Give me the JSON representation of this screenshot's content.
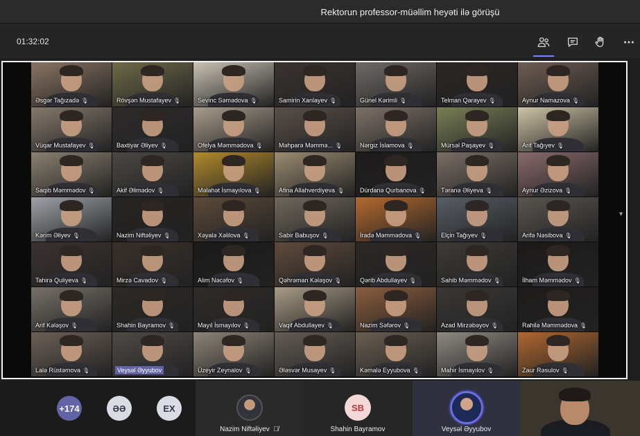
{
  "meeting": {
    "title": "Rektorun professor-müəllim heyəti ilə görüşü",
    "timer": "01:32:02"
  },
  "toolbar": {
    "icons": [
      "people-icon",
      "chat-icon",
      "raise-hand-icon",
      "more-options-icon"
    ]
  },
  "gallery": {
    "participants": [
      "Əsgər Tağızadə",
      "Rövşən Mustafayev",
      "Sevinc Səmədova",
      "Samirin Xanlayev",
      "Günel Kərimli",
      "Telman Qarayev",
      "Aynur Namazova",
      "Vüqar Mustafayev",
      "Baxtiyar Əliyev",
      "Ofelya Məmmədova",
      "Məhparə Məmmə...",
      "Nərgiz İslamova",
      "Mürsəl Paşayev",
      "Arif Tağıyev",
      "Saqib Məmmədov",
      "Akif Əlimədov",
      "Məlahət İsmayılova",
      "Afina Allahverdiyeva",
      "Dürdanə Qurbanova",
      "Təranə Əliyeva",
      "Aynur Əzizova",
      "Kərim Əliyev",
      "Nazim Niftəliyev",
      "Xəyalə Xəlilova",
      "Sabir Babuşov",
      "İradə Məmmədova",
      "Elçin Tağıyev",
      "Arifə Nəsibova",
      "Tahirə Quliyeva",
      "Mirzə Cavadov",
      "Alim Nəcəfov",
      "Qəhrəman Kələşov",
      "Qərib Abdullayev",
      "Sahib Məmmədov",
      "İlham Məmmədov",
      "Arif Kələşov",
      "Shahin Bayramov",
      "Mayıl İsmayılov",
      "Vaqif Abdullayev",
      "Nazim Səfərov",
      "Azad Mirzəbəyov",
      "Rahilə Məmmədova",
      "Lalə Rüstəmova",
      "Veysəl Əyyubov",
      "Üzeyir Zeynalov",
      "Ələsvər Musayev",
      "Kəmalə Eyyubova",
      "Mahir İsmayılov",
      "Zaur Rəsulov"
    ],
    "highlighted": "Veysəl Əyyubov"
  },
  "bottom": {
    "overflow_count": "+174",
    "bubble_1": "ƏƏ",
    "bubble_2": "EX",
    "stage": [
      {
        "name": "Nazim Niftəliyev",
        "muted": true
      },
      {
        "name": "Shahin Bayramov",
        "initials": "SB"
      },
      {
        "name": "Veysəl Əyyubov"
      }
    ]
  },
  "colors": {
    "accent": "#6264a7",
    "background": "#1f1f1f"
  }
}
